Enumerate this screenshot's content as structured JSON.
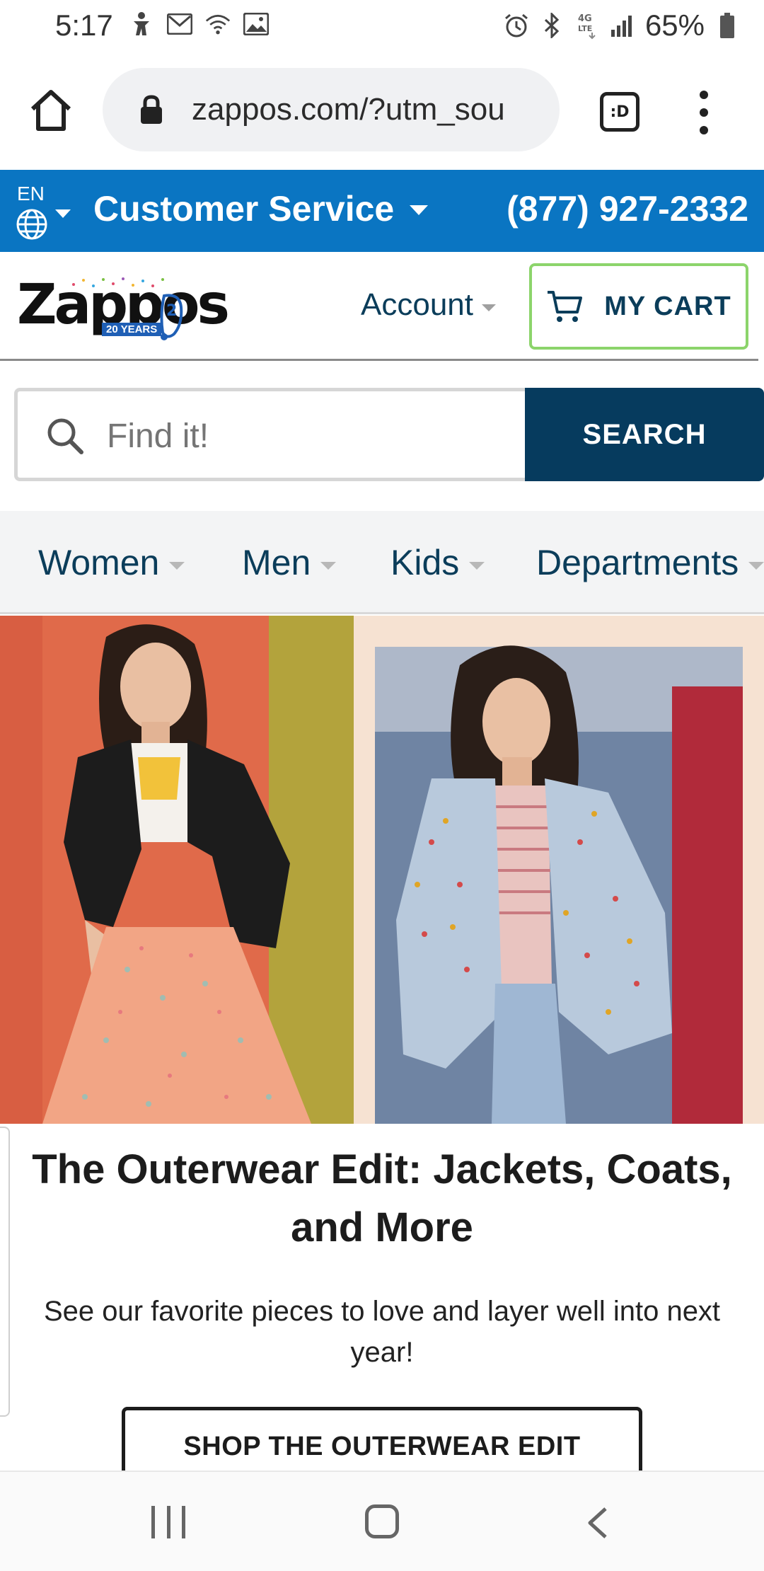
{
  "status_bar": {
    "time": "5:17",
    "battery": "65%",
    "left_icons": [
      "accessibility-icon",
      "gmail-icon",
      "wifi-icon",
      "gallery-icon"
    ],
    "right_icons": [
      "alarm-icon",
      "bluetooth-icon",
      "4g-lte-icon",
      "signal-icon",
      "battery-icon"
    ]
  },
  "browser": {
    "url": "zappos.com/?utm_sou",
    "tabs_label": ":D"
  },
  "utility_bar": {
    "language": "EN",
    "customer_service": "Customer Service",
    "phone": "(877) 927-2332",
    "background": "#0a75c2"
  },
  "header": {
    "logo_text": "Zappos",
    "logo_badge": "20 YEARS",
    "account_label": "Account",
    "cart_label": "MY CART"
  },
  "search": {
    "placeholder": "Find it!",
    "button_label": "SEARCH",
    "button_color": "#063b5e"
  },
  "nav": {
    "items": [
      {
        "label": "Women"
      },
      {
        "label": "Men"
      },
      {
        "label": "Kids"
      },
      {
        "label": "Departments"
      }
    ]
  },
  "promo": {
    "title": "The Outerwear Edit: Jackets, Coats, and More",
    "subtitle": "See our favorite pieces to love and layer well into next year!",
    "button_label": "SHOP THE OUTERWEAR EDIT"
  },
  "colors": {
    "accent_blue": "#0a75c2",
    "navy": "#063b5e",
    "cart_border": "#8cd46b"
  }
}
